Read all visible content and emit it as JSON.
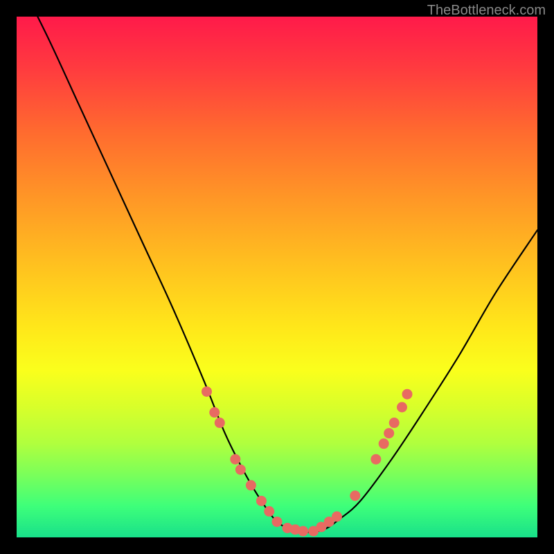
{
  "watermark": "TheBottleneck.com",
  "chart_data": {
    "type": "line",
    "title": "",
    "xlabel": "",
    "ylabel": "",
    "xlim": [
      0,
      100
    ],
    "ylim": [
      0,
      100
    ],
    "series": [
      {
        "name": "curve",
        "x": [
          0,
          6,
          12,
          18,
          24,
          30,
          36,
          40,
          44,
          47,
          50,
          53,
          56,
          59,
          62,
          66,
          72,
          78,
          85,
          92,
          100
        ],
        "values": [
          108,
          96,
          83,
          70,
          57,
          44,
          30,
          20,
          12,
          7,
          3,
          1.5,
          1,
          1.5,
          3.5,
          7,
          15,
          24,
          35,
          47,
          59
        ]
      }
    ],
    "markers": {
      "name": "highlight-dots",
      "color": "#e86a62",
      "points": [
        {
          "x": 36.5,
          "y": 28
        },
        {
          "x": 38.0,
          "y": 24
        },
        {
          "x": 39.0,
          "y": 22
        },
        {
          "x": 42.0,
          "y": 15
        },
        {
          "x": 43.0,
          "y": 13
        },
        {
          "x": 45.0,
          "y": 10
        },
        {
          "x": 47.0,
          "y": 7
        },
        {
          "x": 48.5,
          "y": 5
        },
        {
          "x": 50.0,
          "y": 3
        },
        {
          "x": 52.0,
          "y": 1.8
        },
        {
          "x": 53.5,
          "y": 1.5
        },
        {
          "x": 55.0,
          "y": 1.2
        },
        {
          "x": 57.0,
          "y": 1.2
        },
        {
          "x": 58.5,
          "y": 2
        },
        {
          "x": 60.0,
          "y": 3
        },
        {
          "x": 61.5,
          "y": 4
        },
        {
          "x": 65.0,
          "y": 8
        },
        {
          "x": 69.0,
          "y": 15
        },
        {
          "x": 70.5,
          "y": 18
        },
        {
          "x": 71.5,
          "y": 20
        },
        {
          "x": 72.5,
          "y": 22
        },
        {
          "x": 74.0,
          "y": 25
        },
        {
          "x": 75.0,
          "y": 27.5
        }
      ]
    }
  }
}
